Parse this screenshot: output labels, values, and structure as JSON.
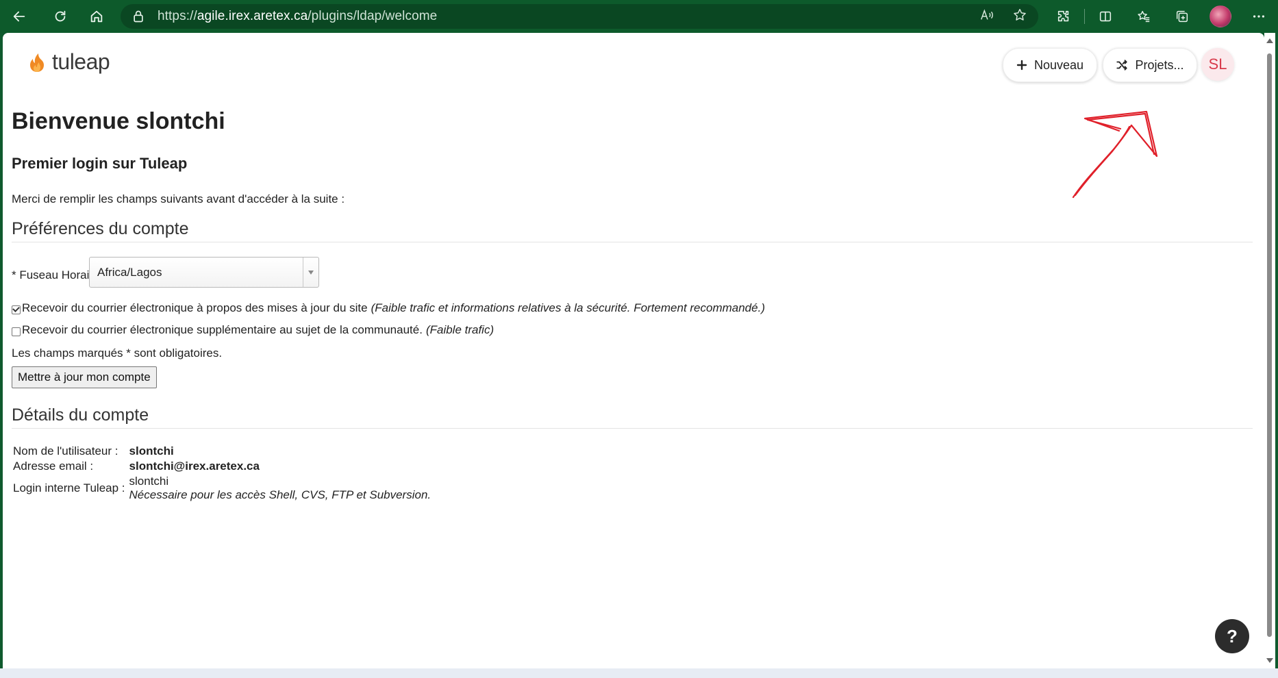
{
  "browser": {
    "url_scheme": "https://",
    "url_host": "agile.irex.aretex.ca",
    "url_path": "/plugins/ldap/welcome"
  },
  "header": {
    "logo_text": "tuleap",
    "new_label": "Nouveau",
    "projects_label": "Projets...",
    "avatar_initials": "SL"
  },
  "main": {
    "title": "Bienvenue slontchi",
    "subtitle": "Premier login sur Tuleap",
    "intro": "Merci de remplir les champs suivants avant d'accéder à la suite :",
    "preferences": {
      "section_title": "Préférences du compte",
      "timezone_label": "* Fuseau Horaire:",
      "timezone_value": "Africa/Lagos",
      "checkbox_site_updates": {
        "label": "Recevoir du courrier électronique à propos des mises à jour du site",
        "note": "(Faible trafic et informations relatives à la sécurité. Fortement recommandé.)",
        "checked": true
      },
      "checkbox_community": {
        "label": "Recevoir du courrier électronique supplémentaire au sujet de la communauté.",
        "note": "(Faible trafic)",
        "checked": false
      },
      "required_note": "Les champs marqués * sont obligatoires.",
      "submit_label": "Mettre à jour mon compte"
    },
    "details": {
      "section_title": "Détails du compte",
      "rows": [
        {
          "label": "Nom de l'utilisateur :",
          "value": "slontchi"
        },
        {
          "label": "Adresse email :",
          "value": "slontchi@irex.aretex.ca"
        },
        {
          "label": "Login interne Tuleap :",
          "value": "slontchi",
          "note": "Nécessaire pour les accès Shell, CVS, FTP et Subversion."
        }
      ]
    }
  },
  "help_label": "?",
  "colors": {
    "chrome_bg": "#0d5a2b",
    "annotation": "#e0202a",
    "brand_orange": "#f08a24",
    "avatar_text": "#d8394a"
  }
}
